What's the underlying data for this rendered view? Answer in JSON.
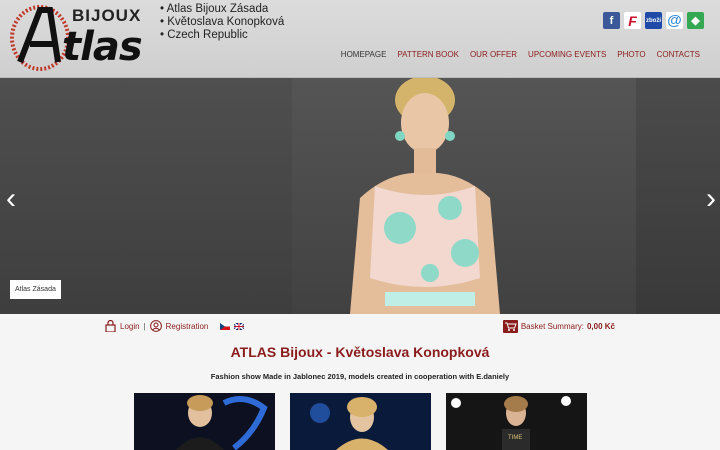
{
  "logo": {
    "word_top": "BIJOUX",
    "word_main": "tlas",
    "letter": "A"
  },
  "tagline": [
    "Atlas Bijoux Zásada",
    "Květoslava Konopková",
    "Czech Republic"
  ],
  "social": [
    "facebook-icon",
    "fler-icon",
    "zbozi-icon",
    "email-icon",
    "google-maps-icon"
  ],
  "nav": [
    "HOMEPAGE",
    "PATTERN BOOK",
    "OUR OFFER",
    "UPCOMING EVENTS",
    "PHOTO",
    "CONTACTS"
  ],
  "slider": {
    "caption": "Atlas Zásada"
  },
  "account": {
    "login": "Login",
    "separator": "|",
    "registration": "Registration"
  },
  "basket": {
    "label": "Basket Summary:",
    "value": "0,00 Kč"
  },
  "main": {
    "title": "ATLAS Bijoux - Květoslava Konopková",
    "subtitle": "Fashion show Made in Jablonec 2019, models created in cooperation with E.daniely"
  },
  "colors": {
    "accent": "#8a1c1c",
    "header_bg": "#d6d6d6"
  }
}
